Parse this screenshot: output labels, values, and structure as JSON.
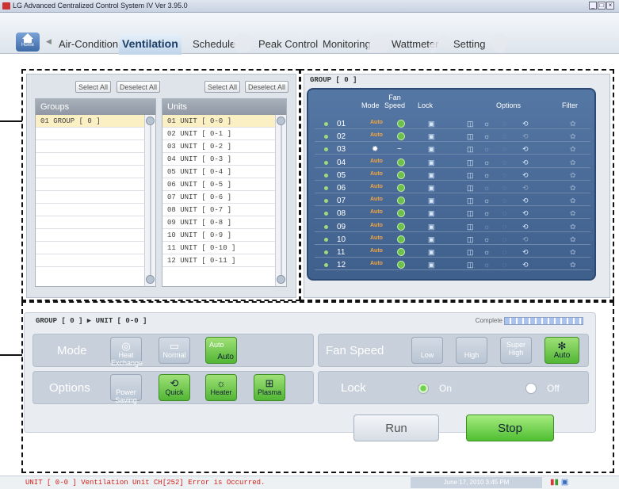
{
  "window": {
    "title": "LG Advanced Centralized Control System IV Ver 3.95.0"
  },
  "nav": {
    "home_label": "Home",
    "tabs": [
      "Air-Condition",
      "Ventilation",
      "Schedule",
      "Peak Control",
      "Monitoring",
      "Wattmeter",
      "Setting"
    ],
    "active_tab": "Ventilation"
  },
  "groups_panel": {
    "select_all": "Select All",
    "deselect_all": "Deselect All",
    "groups_header": "Groups",
    "units_header": "Units",
    "groups": [
      "01  GROUP [ 0 ]"
    ],
    "units": [
      "01  UNIT [ 0-0 ]",
      "02  UNIT [ 0-1 ]",
      "03  UNIT [ 0-2 ]",
      "04  UNIT [ 0-3 ]",
      "05  UNIT [ 0-4 ]",
      "06  UNIT [ 0-5 ]",
      "07  UNIT [ 0-6 ]",
      "08  UNIT [ 0-7 ]",
      "09  UNIT [ 0-8 ]",
      "10  UNIT [ 0-9 ]",
      "11  UNIT [ 0-10 ]",
      "12  UNIT [ 0-11 ]"
    ]
  },
  "status_grid": {
    "title": "GROUP [ 0 ]",
    "columns": {
      "mode": "Mode",
      "fan_speed": "Fan Speed",
      "lock": "Lock",
      "options": "Options",
      "filter": "Filter"
    },
    "rows": [
      {
        "no": "01",
        "mode": "Auto",
        "fan": "on"
      },
      {
        "no": "02",
        "mode": "Auto",
        "fan": "on"
      },
      {
        "no": "03",
        "mode": "heat-exchange",
        "fan": "off"
      },
      {
        "no": "04",
        "mode": "Auto",
        "fan": "on"
      },
      {
        "no": "05",
        "mode": "Auto",
        "fan": "on"
      },
      {
        "no": "06",
        "mode": "Auto",
        "fan": "on"
      },
      {
        "no": "07",
        "mode": "Auto",
        "fan": "on"
      },
      {
        "no": "08",
        "mode": "Auto",
        "fan": "on"
      },
      {
        "no": "09",
        "mode": "Auto",
        "fan": "on"
      },
      {
        "no": "10",
        "mode": "Auto",
        "fan": "on"
      },
      {
        "no": "11",
        "mode": "Auto",
        "fan": "on"
      },
      {
        "no": "12",
        "mode": "Auto",
        "fan": "on"
      }
    ]
  },
  "control": {
    "breadcrumb": "GROUP [ 0 ] ▶ UNIT [ 0-0 ]",
    "complete_label": "Complete",
    "mode": {
      "label": "Mode",
      "heat_exchange": "Heat Exchange",
      "normal": "Normal",
      "auto_top": "Auto",
      "auto": "Auto",
      "selected": "Auto"
    },
    "fan_speed": {
      "label": "Fan Speed",
      "low": "Low",
      "high": "High",
      "super_high": "Super High",
      "auto": "Auto",
      "selected": "Auto"
    },
    "options": {
      "label": "Options",
      "power_saving": "Power Saving",
      "quick": "Quick",
      "heater": "Heater",
      "plasma": "Plasma"
    },
    "lock": {
      "label": "Lock",
      "on": "On",
      "off": "Off",
      "selected": "On"
    },
    "run": "Run",
    "stop": "Stop"
  },
  "status": {
    "error": "UNIT [ 0-0 ] Ventilation Unit CH[252] Error is Occurred.",
    "datetime": "June 17, 2010  3:45 PM"
  },
  "colors": {
    "accent_green": "#52b635",
    "panel_blue": "#3f5f8c",
    "error_red": "#d1221b"
  }
}
